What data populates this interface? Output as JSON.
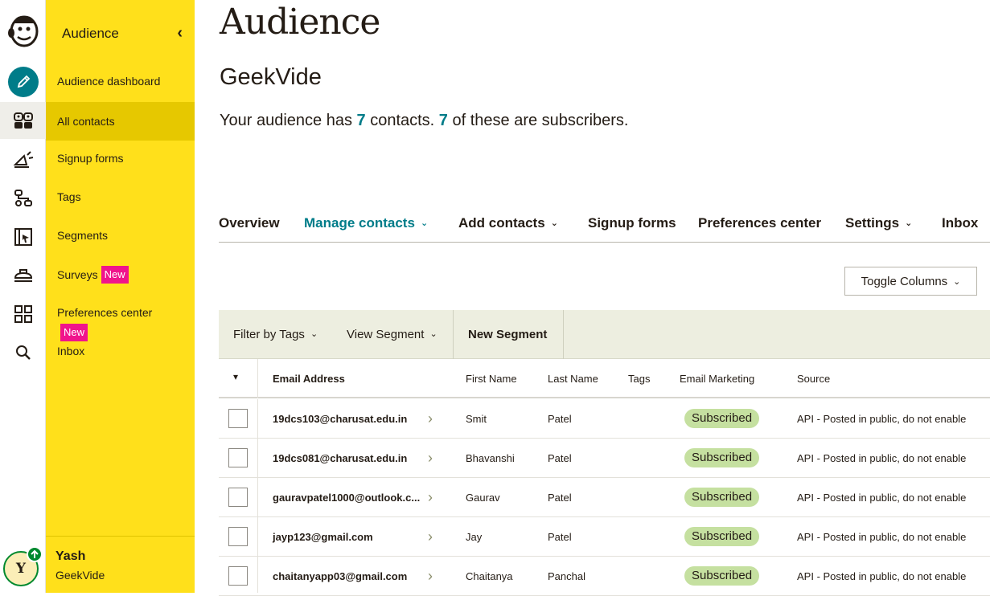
{
  "nav": {
    "section_title": "Audience",
    "collapse_icon": "chevron-left-icon",
    "items": [
      {
        "label": "Audience dashboard"
      },
      {
        "label": "All contacts"
      },
      {
        "label": "Signup forms"
      },
      {
        "label": "Tags"
      },
      {
        "label": "Segments"
      },
      {
        "label": "Surveys",
        "badge": "New"
      },
      {
        "label": "Preferences center",
        "badge": "New"
      },
      {
        "label": "Inbox"
      }
    ],
    "user": {
      "name": "Yash",
      "org": "GeekVide",
      "initial": "Y"
    }
  },
  "rail": {
    "icons": [
      "freddie-logo-icon",
      "pencil-icon",
      "audience-icon",
      "campaign-icon",
      "automation-icon",
      "website-icon",
      "content-icon",
      "integrations-icon",
      "search-icon"
    ]
  },
  "header": {
    "title": "Audience",
    "audience_name": "GeekVide",
    "summary_prefix": "Your audience has ",
    "contacts_count": "7",
    "summary_mid": " contacts. ",
    "subscribers_count": "7",
    "summary_suffix": " of these are subscribers."
  },
  "tabs": [
    {
      "label": "Overview",
      "dropdown": false
    },
    {
      "label": "Manage contacts",
      "dropdown": true,
      "active": true
    },
    {
      "label": "Add contacts",
      "dropdown": true
    },
    {
      "label": "Signup forms",
      "dropdown": false
    },
    {
      "label": "Preferences center",
      "dropdown": false
    },
    {
      "label": "Settings",
      "dropdown": true
    },
    {
      "label": "Inbox",
      "dropdown": false
    }
  ],
  "toolbar": {
    "toggle_columns": "Toggle Columns",
    "filter_by_tags": "Filter by Tags",
    "view_segment": "View Segment",
    "new_segment": "New Segment"
  },
  "table": {
    "columns": [
      "Email Address",
      "First Name",
      "Last Name",
      "Tags",
      "Email Marketing",
      "Source"
    ],
    "rows": [
      {
        "email": "19dcs103@charusat.edu.in",
        "first": "Smit",
        "last": "Patel",
        "tags": "",
        "status": "Subscribed",
        "source": "API - Posted in public, do not enable"
      },
      {
        "email": "19dcs081@charusat.edu.in",
        "first": "Bhavanshi",
        "last": "Patel",
        "tags": "",
        "status": "Subscribed",
        "source": "API - Posted in public, do not enable"
      },
      {
        "email": "gauravpatel1000@outlook.c...",
        "first": "Gaurav",
        "last": "Patel",
        "tags": "",
        "status": "Subscribed",
        "source": "API - Posted in public, do not enable"
      },
      {
        "email": "jayp123@gmail.com",
        "first": "Jay",
        "last": "Patel",
        "tags": "",
        "status": "Subscribed",
        "source": "API - Posted in public, do not enable"
      },
      {
        "email": "chaitanyapp03@gmail.com",
        "first": "Chaitanya",
        "last": "Panchal",
        "tags": "",
        "status": "Subscribed",
        "source": "API - Posted in public, do not enable"
      }
    ]
  },
  "colors": {
    "brand_yellow": "#ffe01b",
    "teal": "#007c89",
    "badge_pink": "#f0148c",
    "subscribed_green": "#c5e0a0"
  }
}
